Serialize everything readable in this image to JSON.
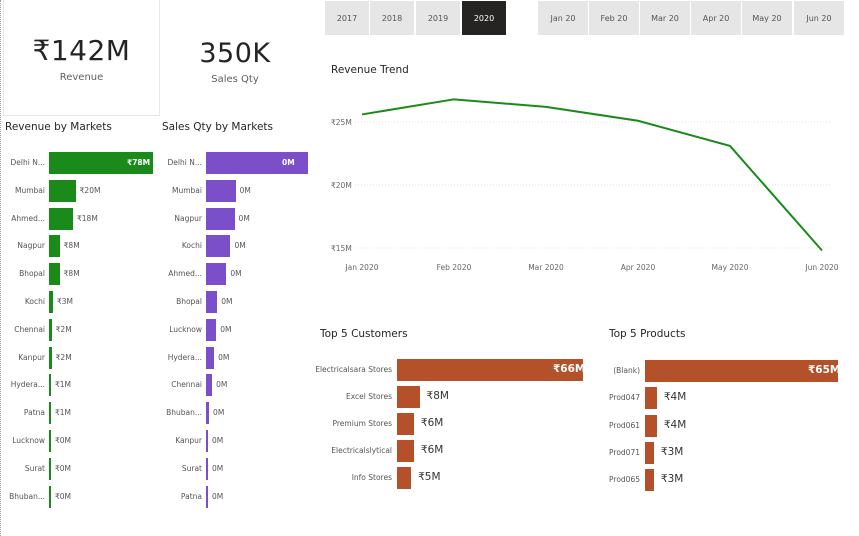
{
  "kpis": {
    "revenue": {
      "value": "₹142M",
      "label": "Revenue"
    },
    "sales_qty": {
      "value": "350K",
      "label": "Sales Qty"
    }
  },
  "year_slicer": [
    "2017",
    "2018",
    "2019",
    "2020"
  ],
  "year_selected": "2020",
  "month_slicer": [
    "Jan 20",
    "Feb 20",
    "Mar 20",
    "Apr 20",
    "May 20",
    "Jun 20"
  ],
  "revenue_by_markets": {
    "title": "Revenue by Markets",
    "color": "#1a8a1a",
    "items": [
      {
        "label": "Delhi N...",
        "value": 78,
        "display": "₹78M"
      },
      {
        "label": "Mumbai",
        "value": 20,
        "display": "₹20M"
      },
      {
        "label": "Ahmed...",
        "value": 18,
        "display": "₹18M"
      },
      {
        "label": "Nagpur",
        "value": 8,
        "display": "₹8M"
      },
      {
        "label": "Bhopal",
        "value": 8,
        "display": "₹8M"
      },
      {
        "label": "Kochi",
        "value": 3,
        "display": "₹3M"
      },
      {
        "label": "Chennai",
        "value": 2,
        "display": "₹2M"
      },
      {
        "label": "Kanpur",
        "value": 2,
        "display": "₹2M"
      },
      {
        "label": "Hydera...",
        "value": 1,
        "display": "₹1M"
      },
      {
        "label": "Patna",
        "value": 1,
        "display": "₹1M"
      },
      {
        "label": "Lucknow",
        "value": 0.3,
        "display": "₹0M"
      },
      {
        "label": "Surat",
        "value": 0.2,
        "display": "₹0M"
      },
      {
        "label": "Bhuban...",
        "value": 0.1,
        "display": "₹0M"
      }
    ]
  },
  "sales_qty_by_markets": {
    "title": "Sales Qty by Markets",
    "color": "#7b4fc9",
    "items": [
      {
        "label": "Delhi N...",
        "value": 100,
        "display": "0M"
      },
      {
        "label": "Mumbai",
        "value": 29,
        "display": "0M"
      },
      {
        "label": "Nagpur",
        "value": 28,
        "display": "0M"
      },
      {
        "label": "Kochi",
        "value": 24,
        "display": "0M"
      },
      {
        "label": "Ahmed...",
        "value": 20,
        "display": "0M"
      },
      {
        "label": "Bhopal",
        "value": 11,
        "display": "0M"
      },
      {
        "label": "Lucknow",
        "value": 10,
        "display": "0M"
      },
      {
        "label": "Hydera...",
        "value": 8,
        "display": "0M"
      },
      {
        "label": "Chennai",
        "value": 6,
        "display": "0M"
      },
      {
        "label": "Bhuban...",
        "value": 3,
        "display": "0M"
      },
      {
        "label": "Kanpur",
        "value": 2,
        "display": "0M"
      },
      {
        "label": "Surat",
        "value": 2,
        "display": "0M"
      },
      {
        "label": "Patna",
        "value": 2,
        "display": "0M"
      }
    ]
  },
  "revenue_trend": {
    "title": "Revenue Trend",
    "color": "#1a8a1a",
    "yticks": [
      {
        "value": 25,
        "label": "₹25M"
      },
      {
        "value": 20,
        "label": "₹20M"
      },
      {
        "value": 15,
        "label": "₹15M"
      }
    ]
  },
  "top_customers": {
    "title": "Top 5 Customers",
    "color": "#b5512a",
    "items": [
      {
        "label": "Electricalsara Stores",
        "value": 66,
        "display": "₹66M"
      },
      {
        "label": "Excel Stores",
        "value": 8,
        "display": "₹8M"
      },
      {
        "label": "Premium Stores",
        "value": 6,
        "display": "₹6M"
      },
      {
        "label": "Electricalslytical",
        "value": 6,
        "display": "₹6M"
      },
      {
        "label": "Info Stores",
        "value": 5,
        "display": "₹5M"
      }
    ]
  },
  "top_products": {
    "title": "Top 5 Products",
    "color": "#b5512a",
    "items": [
      {
        "label": "(Blank)",
        "value": 65,
        "display": "₹65M"
      },
      {
        "label": "Prod047",
        "value": 4,
        "display": "₹4M"
      },
      {
        "label": "Prod061",
        "value": 4,
        "display": "₹4M"
      },
      {
        "label": "Prod071",
        "value": 3,
        "display": "₹3M"
      },
      {
        "label": "Prod065",
        "value": 3,
        "display": "₹3M"
      }
    ]
  },
  "chart_data": [
    {
      "type": "line",
      "title": "Revenue Trend",
      "xlabel": "",
      "ylabel": "",
      "x": [
        "Jan 2020",
        "Feb 2020",
        "Mar 2020",
        "Apr 2020",
        "May 2020",
        "Jun 2020"
      ],
      "series": [
        {
          "values": [
            25.6,
            26.8,
            26.2,
            25.1,
            23.1,
            14.8
          ]
        }
      ],
      "ylim": [
        14,
        27.5
      ],
      "grid": true
    },
    {
      "type": "bar",
      "title": "Revenue by Markets",
      "categories": [
        "Delhi N...",
        "Mumbai",
        "Ahmed...",
        "Nagpur",
        "Bhopal",
        "Kochi",
        "Chennai",
        "Kanpur",
        "Hydera...",
        "Patna",
        "Lucknow",
        "Surat",
        "Bhuban..."
      ],
      "values": [
        78,
        20,
        18,
        8,
        8,
        3,
        2,
        2,
        1,
        1,
        0.3,
        0.2,
        0.1
      ]
    },
    {
      "type": "bar",
      "title": "Sales Qty by Markets",
      "categories": [
        "Delhi N...",
        "Mumbai",
        "Nagpur",
        "Kochi",
        "Ahmed...",
        "Bhopal",
        "Lucknow",
        "Hydera...",
        "Chennai",
        "Bhuban...",
        "Kanpur",
        "Surat",
        "Patna"
      ],
      "values": [
        100,
        29,
        28,
        24,
        20,
        11,
        10,
        8,
        6,
        3,
        2,
        2,
        2
      ]
    },
    {
      "type": "bar",
      "title": "Top 5 Customers",
      "categories": [
        "Electricalsara Stores",
        "Excel Stores",
        "Premium Stores",
        "Electricalslytical",
        "Info Stores"
      ],
      "values": [
        66,
        8,
        6,
        6,
        5
      ]
    },
    {
      "type": "bar",
      "title": "Top 5 Products",
      "categories": [
        "(Blank)",
        "Prod047",
        "Prod061",
        "Prod071",
        "Prod065"
      ],
      "values": [
        65,
        4,
        4,
        3,
        3
      ]
    }
  ]
}
